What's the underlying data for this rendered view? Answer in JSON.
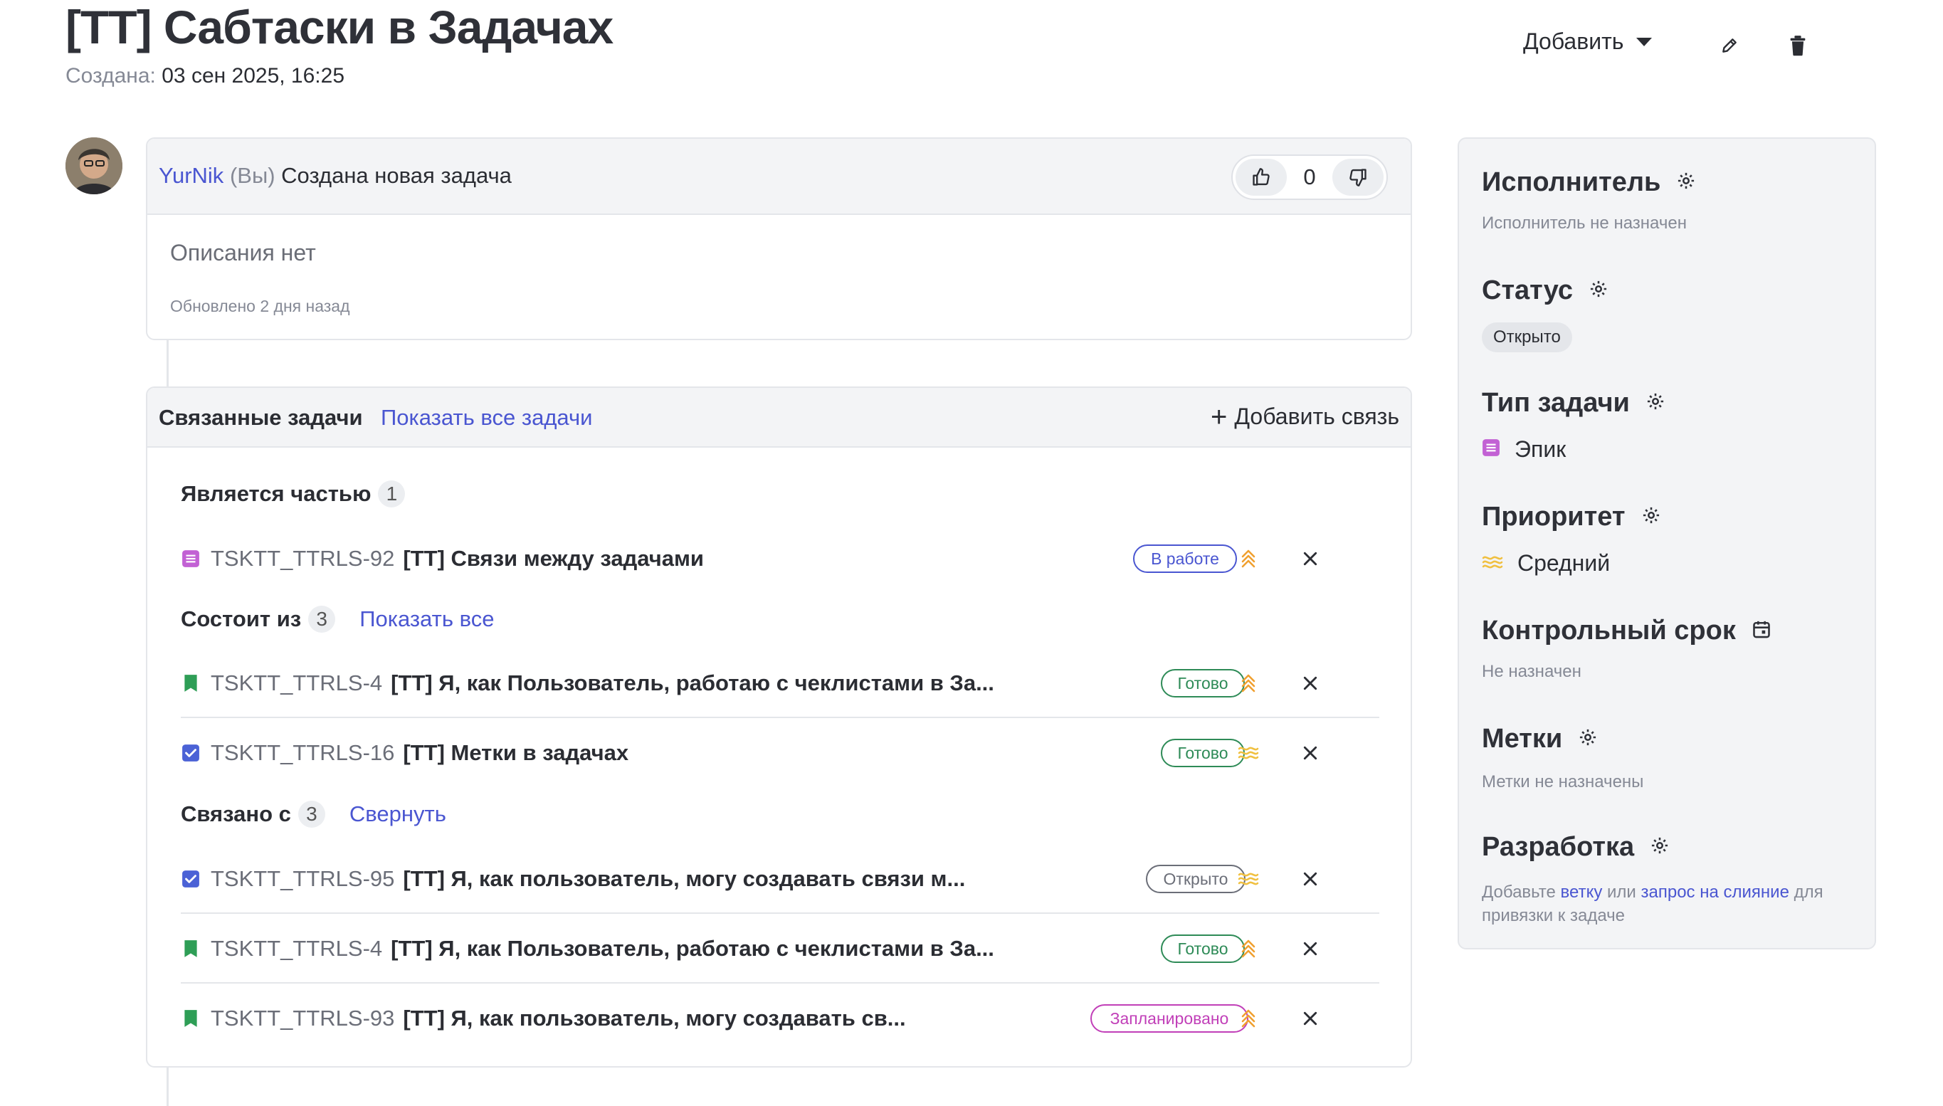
{
  "header": {
    "title": "[TT] Сабтаски в Задачах",
    "created_label": "Создана:",
    "created_value": "03 сен 2025, 16:25",
    "add_label": "Добавить"
  },
  "comment": {
    "author": "YurNik",
    "you": "(Вы)",
    "action": "Создана новая задача",
    "votes": "0",
    "description": "Описания нет",
    "updated": "Обновлено 2 дня назад"
  },
  "links": {
    "title": "Связанные задачи",
    "show_all_tasks": "Показать все задачи",
    "add_link": "Добавить связь",
    "groups": [
      {
        "title": "Является частью",
        "count": "1",
        "action": "",
        "items": [
          {
            "key": "TSKTT_TTRLS-92",
            "name": "[TT] Связи между задачами",
            "status": "В работе",
            "type": "epic",
            "priority": "high"
          }
        ]
      },
      {
        "title": "Состоит из",
        "count": "3",
        "action": "Показать все",
        "items": [
          {
            "key": "TSKTT_TTRLS-4",
            "name": "[TT] Я, как Пользователь, работаю с чеклистами в За...",
            "status": "Готово",
            "type": "story",
            "priority": "high"
          },
          {
            "key": "TSKTT_TTRLS-16",
            "name": "[TT] Метки в задачах",
            "status": "Готово",
            "type": "task",
            "priority": "medium"
          }
        ]
      },
      {
        "title": "Связано с",
        "count": "3",
        "action": "Свернуть",
        "items": [
          {
            "key": "TSKTT_TTRLS-95",
            "name": "[TT] Я, как пользователь, могу создавать связи м...",
            "status": "Открыто",
            "type": "task",
            "priority": "medium"
          },
          {
            "key": "TSKTT_TTRLS-4",
            "name": "[TT] Я, как Пользователь, работаю с чеклистами в За...",
            "status": "Готово",
            "type": "story",
            "priority": "high"
          },
          {
            "key": "TSKTT_TTRLS-93",
            "name": "[TT] Я, как пользователь, могу создавать св...",
            "status": "Запланировано",
            "type": "story",
            "priority": "high"
          }
        ]
      }
    ]
  },
  "sidebar": {
    "assignee": {
      "title": "Исполнитель",
      "value": "Исполнитель не назначен"
    },
    "status": {
      "title": "Статус",
      "value": "Открыто"
    },
    "type": {
      "title": "Тип задачи",
      "value": "Эпик"
    },
    "priority": {
      "title": "Приоритет",
      "value": "Средний"
    },
    "deadline": {
      "title": "Контрольный срок",
      "value": "Не назначен"
    },
    "labels": {
      "title": "Метки",
      "value": "Метки не назначены"
    },
    "dev": {
      "title": "Разработка",
      "text1": "Добавьте",
      "link1": "ветку",
      "text2": "или",
      "link2": "запрос на слияние",
      "text3": "для привязки к задаче"
    }
  },
  "colors": {
    "accent": "#4a56d1",
    "status_in_progress": "#4a56d1",
    "status_done": "#2e8b57",
    "status_open": "#6b6e78",
    "status_planned": "#c13fb8",
    "priority": "#f0a030",
    "epic": "#c261d4",
    "story": "#2e9e56",
    "task": "#4b62d6"
  }
}
